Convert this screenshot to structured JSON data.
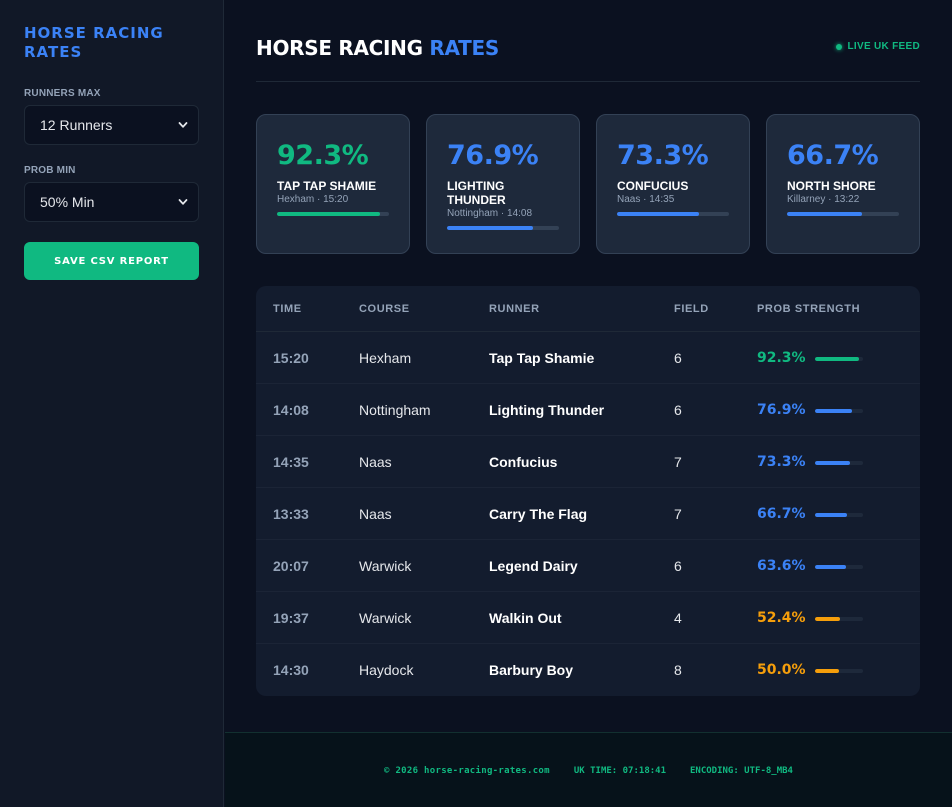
{
  "sidebar": {
    "brand": "HORSE RACING RATES",
    "runners_label": "RUNNERS MAX",
    "runners_value": "12 Runners",
    "prob_label": "PROB MIN",
    "prob_value": "50% Min",
    "save_label": "SAVE CSV REPORT"
  },
  "header": {
    "title_main": "HORSE RACING",
    "title_accent": "RATES",
    "live_label": "LIVE UK FEED"
  },
  "cards": [
    {
      "pct": "92.3%",
      "name": "TAP TAP SHAMIE",
      "meta": "Hexham · 15:20",
      "fill": 0.92,
      "color": "#10b981"
    },
    {
      "pct": "76.9%",
      "name": "LIGHTING THUNDER",
      "meta": "Nottingham · 14:08",
      "fill": 0.77,
      "color": "#3b82f6"
    },
    {
      "pct": "73.3%",
      "name": "CONFUCIUS",
      "meta": "Naas · 14:35",
      "fill": 0.73,
      "color": "#3b82f6"
    },
    {
      "pct": "66.7%",
      "name": "NORTH SHORE",
      "meta": "Killarney · 13:22",
      "fill": 0.67,
      "color": "#3b82f6"
    }
  ],
  "table": {
    "headers": [
      "TIME",
      "COURSE",
      "RUNNER",
      "FIELD",
      "PROB STRENGTH"
    ],
    "rows": [
      {
        "time": "15:20",
        "course": "Hexham",
        "runner": "Tap Tap Shamie",
        "field": "6",
        "prob": "92.3%",
        "fill": 0.923,
        "color": "#10b981"
      },
      {
        "time": "14:08",
        "course": "Nottingham",
        "runner": "Lighting Thunder",
        "field": "6",
        "prob": "76.9%",
        "fill": 0.769,
        "color": "#3b82f6"
      },
      {
        "time": "14:35",
        "course": "Naas",
        "runner": "Confucius",
        "field": "7",
        "prob": "73.3%",
        "fill": 0.733,
        "color": "#3b82f6"
      },
      {
        "time": "13:33",
        "course": "Naas",
        "runner": "Carry The Flag",
        "field": "7",
        "prob": "66.7%",
        "fill": 0.667,
        "color": "#3b82f6"
      },
      {
        "time": "20:07",
        "course": "Warwick",
        "runner": "Legend Dairy",
        "field": "6",
        "prob": "63.6%",
        "fill": 0.636,
        "color": "#3b82f6"
      },
      {
        "time": "19:37",
        "course": "Warwick",
        "runner": "Walkin Out",
        "field": "4",
        "prob": "52.4%",
        "fill": 0.524,
        "color": "#f59e0b"
      },
      {
        "time": "14:30",
        "course": "Haydock",
        "runner": "Barbury Boy",
        "field": "8",
        "prob": "50.0%",
        "fill": 0.5,
        "color": "#f59e0b"
      }
    ]
  },
  "footer": {
    "copyright": "© 2026 horse-racing-rates.com",
    "uk_time": "UK TIME: 07:18:41",
    "encoding": "ENCODING: UTF-8_MB4"
  }
}
